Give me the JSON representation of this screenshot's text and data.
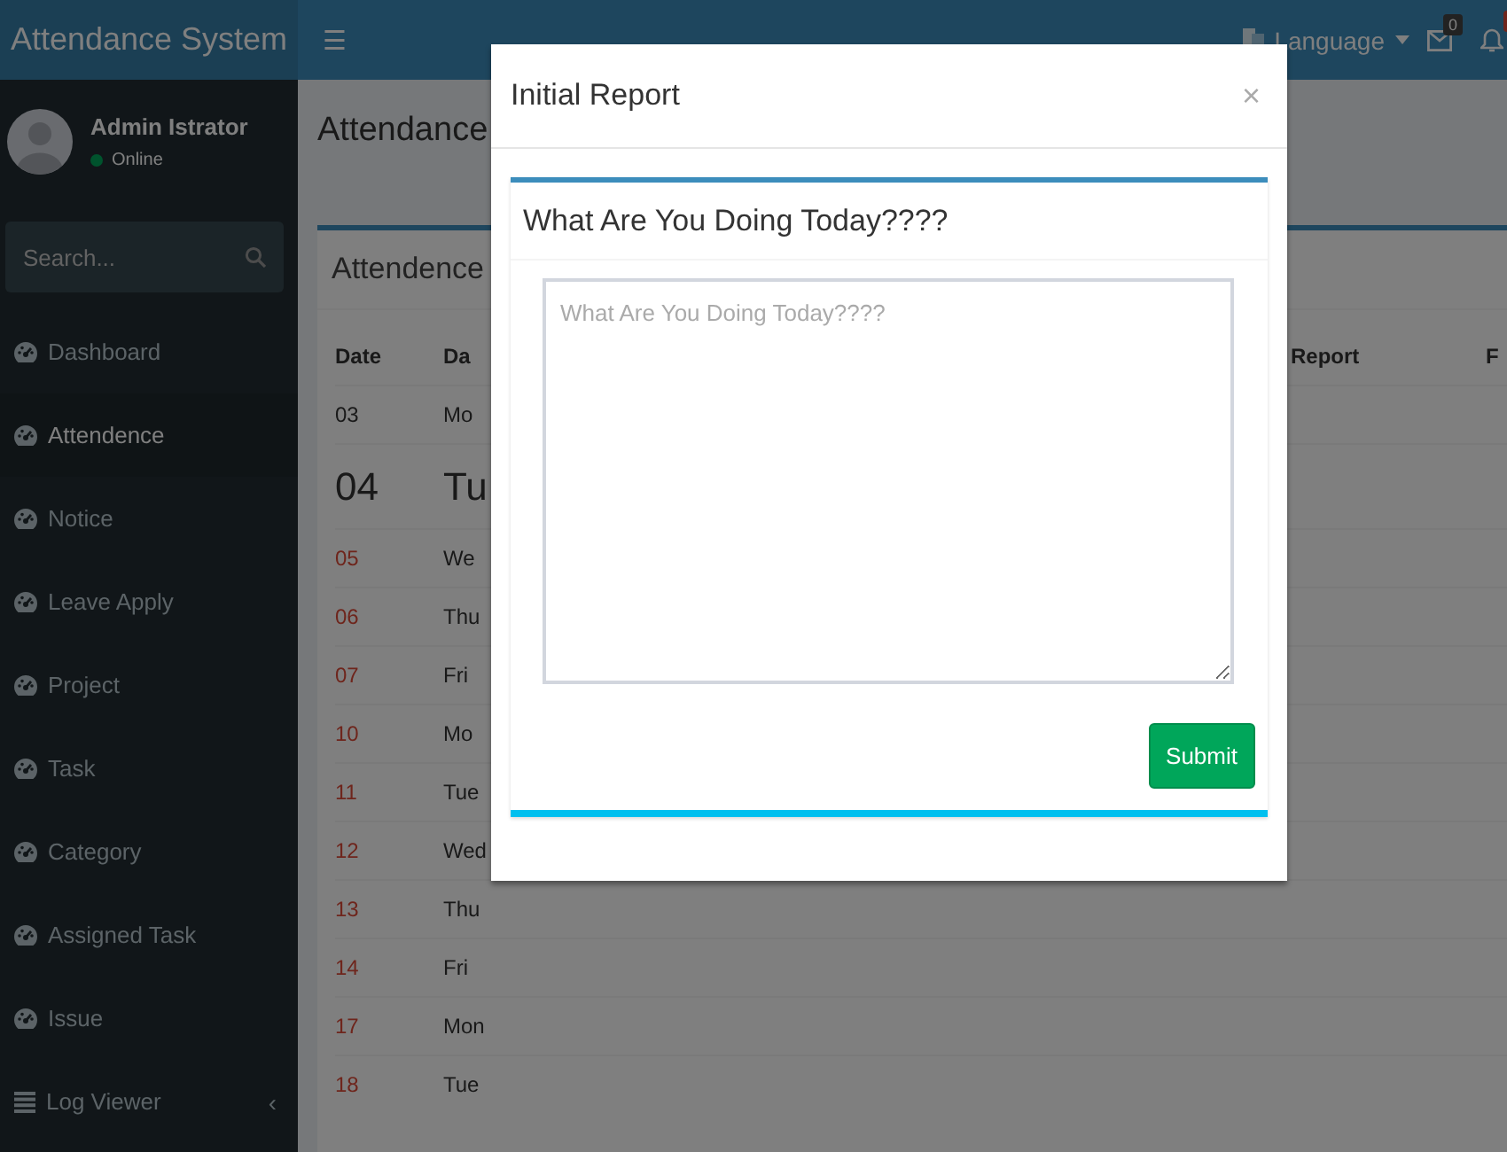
{
  "header": {
    "logo": "Attendance System",
    "menu_toggle": "☰",
    "language": "Language",
    "mail_count": "0"
  },
  "sidebar": {
    "user": {
      "name": "Admin Istrator",
      "status": "Online"
    },
    "search": {
      "placeholder": "Search..."
    },
    "items": [
      {
        "label": "Dashboard",
        "kind": "gauge",
        "selected": false
      },
      {
        "label": "Attendence",
        "kind": "gauge",
        "selected": true
      },
      {
        "label": "Notice",
        "kind": "gauge",
        "selected": false
      },
      {
        "label": "Leave Apply",
        "kind": "gauge",
        "selected": false
      },
      {
        "label": "Project",
        "kind": "gauge",
        "selected": false
      },
      {
        "label": "Task",
        "kind": "gauge",
        "selected": false
      },
      {
        "label": "Category",
        "kind": "gauge",
        "selected": false
      },
      {
        "label": "Assigned Task",
        "kind": "gauge",
        "selected": false
      },
      {
        "label": "Issue",
        "kind": "gauge",
        "selected": false
      },
      {
        "label": "Log Viewer",
        "kind": "list",
        "selected": false,
        "expander": "‹"
      }
    ]
  },
  "page_title": "Attendance",
  "table": {
    "title": "Attendence",
    "columns": [
      "Date",
      "Da",
      "Report",
      "F"
    ],
    "rows": [
      {
        "date": "03",
        "day": "Mo",
        "kind": "normal"
      },
      {
        "date": "04",
        "day": "Tu",
        "kind": "today"
      },
      {
        "date": "05",
        "day": "We",
        "kind": "off"
      },
      {
        "date": "06",
        "day": "Thu",
        "kind": "off"
      },
      {
        "date": "07",
        "day": "Fri",
        "kind": "off"
      },
      {
        "date": "10",
        "day": "Mo",
        "kind": "off"
      },
      {
        "date": "11",
        "day": "Tue",
        "kind": "off"
      },
      {
        "date": "12",
        "day": "Wed",
        "kind": "off"
      },
      {
        "date": "13",
        "day": "Thu",
        "kind": "off"
      },
      {
        "date": "14",
        "day": "Fri",
        "kind": "off"
      },
      {
        "date": "17",
        "day": "Mon",
        "kind": "off"
      },
      {
        "date": "18",
        "day": "Tue",
        "kind": "off"
      }
    ]
  },
  "modal": {
    "title": "Initial Report",
    "close": "×",
    "box_title": "What Are You Doing Today????",
    "textarea": {
      "placeholder": "What Are You Doing Today????"
    },
    "submit": "Submit"
  }
}
